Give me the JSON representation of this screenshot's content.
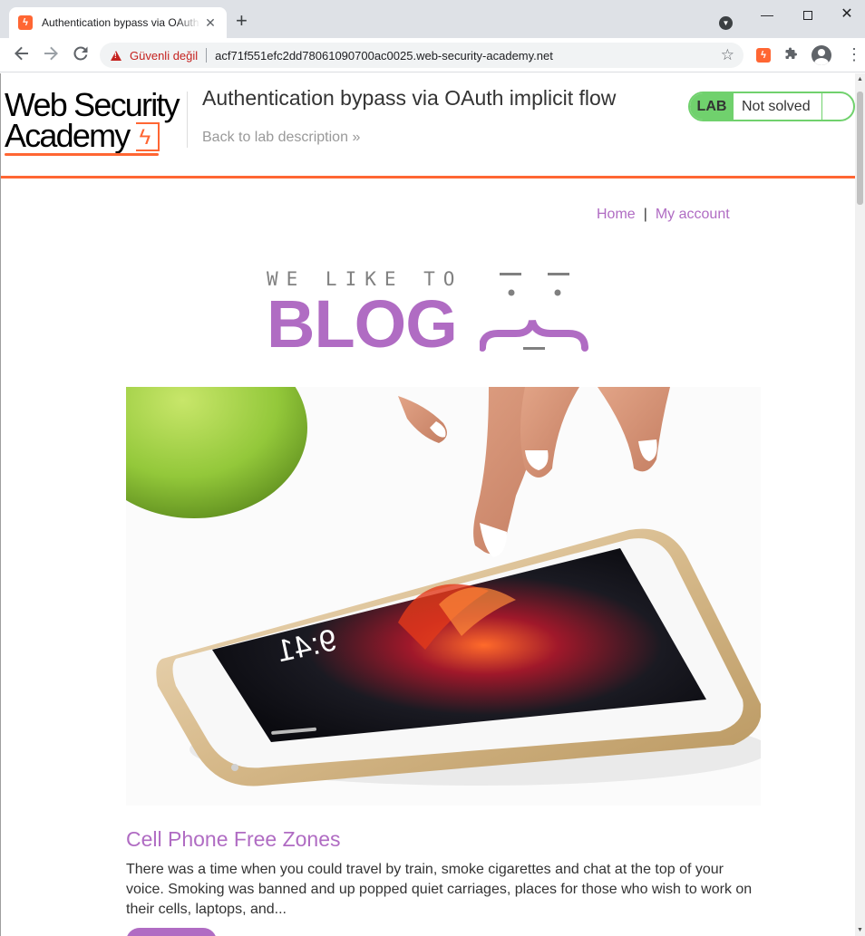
{
  "browser": {
    "tab_title": "Authentication bypass via OAuth implicit flow",
    "tab_close_glyph": "✕",
    "new_tab_glyph": "+",
    "security_label": "Güvenli değil",
    "url": "acf71f551efc2dd78061090700ac0025.web-security-academy.net",
    "icons": [
      "back-icon",
      "forward-icon",
      "reload-icon",
      "warning-icon",
      "star-icon",
      "extension-icon",
      "puzzle-icon",
      "profile-icon",
      "menu-icon"
    ]
  },
  "lab_header": {
    "logo_line1": "Web Security",
    "logo_line2": "Academy",
    "title": "Authentication bypass via OAuth implicit flow",
    "back_link": "Back to lab description",
    "back_link_chevron": "»",
    "status_badge": "LAB",
    "status_text": "Not solved",
    "accent_color": "#ff6633",
    "status_color": "#70d16d"
  },
  "nav": {
    "home": "Home",
    "separator": "|",
    "my_account": "My account"
  },
  "banner": {
    "tagline": "WE LIKE TO",
    "word": "BLOG",
    "color": "#b06cc3"
  },
  "post": {
    "title": "Cell Phone Free Zones",
    "excerpt": "There was a time when you could travel by train, smoke cigarettes and chat at the top of your voice. Smoking was banned and up popped quiet carriages, places for those who wish to work on their cells, laptops, and...",
    "image_subject": "hand touching smartphone screen next to green apple"
  }
}
